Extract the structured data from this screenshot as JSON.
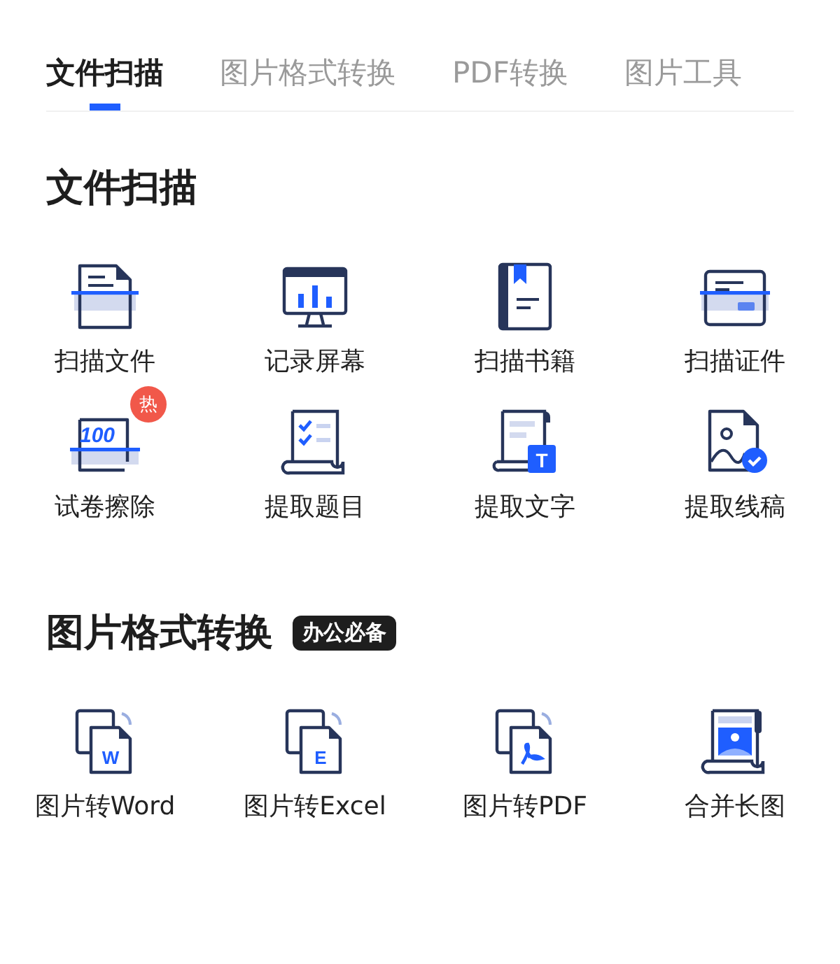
{
  "tabs": [
    {
      "label": "文件扫描",
      "selected": true
    },
    {
      "label": "图片格式转换",
      "selected": false
    },
    {
      "label": "PDF转换",
      "selected": false
    },
    {
      "label": "图片工具",
      "selected": false
    }
  ],
  "sections": [
    {
      "title": "文件扫描",
      "tools": [
        {
          "label": "扫描文件",
          "kind": "scan-doc"
        },
        {
          "label": "记录屏幕",
          "kind": "screen"
        },
        {
          "label": "扫描书籍",
          "kind": "book"
        },
        {
          "label": "扫描证件",
          "kind": "card"
        },
        {
          "label": "试卷擦除",
          "kind": "exam",
          "glyph": "100",
          "badge": "热"
        },
        {
          "label": "提取题目",
          "kind": "checklist"
        },
        {
          "label": "提取文字",
          "kind": "text",
          "glyph": "T"
        },
        {
          "label": "提取线稿",
          "kind": "lineart"
        }
      ]
    },
    {
      "title": "图片格式转换",
      "tag": "办公必备",
      "tools": [
        {
          "label": "图片转Word",
          "kind": "convert",
          "glyph": "W"
        },
        {
          "label": "图片转Excel",
          "kind": "convert",
          "glyph": "E"
        },
        {
          "label": "图片转PDF",
          "kind": "pdf"
        },
        {
          "label": "合并长图",
          "kind": "long"
        }
      ]
    }
  ]
}
